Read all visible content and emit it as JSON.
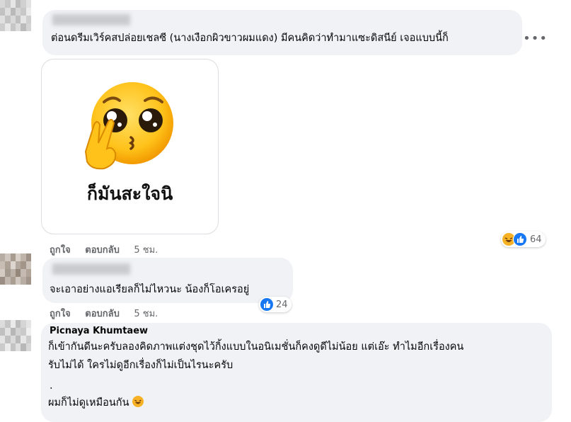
{
  "comments": [
    {
      "text": "ต่อนดรีมเวิร์คสปล่อยเชลซี (นางเงือกผิวขาวผมแดง) มีคนคิดว่าทำมาแซะดิสนีย์ เจอแบบนี้ก็",
      "sticker_caption": "ก็มันสะใจนิ",
      "like_label": "ถูกใจ",
      "reply_label": "ตอบกลับ",
      "time": "5 ชม.",
      "reaction_count": "64",
      "more_icon": "more-horizontal-icon"
    },
    {
      "text": "จะเอาอย่างแอเรียลก็ไม่ไหวนะ น้องก็โอเครอยู่",
      "like_label": "ถูกใจ",
      "reply_label": "ตอบกลับ",
      "time": "5 ชม.",
      "reaction_count": "24"
    },
    {
      "author": "Picnaya Khumtaew",
      "line1": "ก็เข้ากันดีนะครับลองคิดภาพแต่งชุดไว้กิ้งแบบในอนิเมชั่นก็คงดูดีไม่น้อย แต่เอ๊ะ ทำไมอีกเรื่องคน",
      "line2": "รับไม่ได้ ใครไม่ดูอีกเรื่องก็ไม่เป็นไรนะครับ",
      "line3": ".",
      "line4": "ผมก็ไม่ดูเหมือนกัน"
    }
  ],
  "colors": {
    "bubble": "#f0f2f5",
    "meta": "#65676b",
    "like_blue": "#1877f2",
    "haha_yellow": "#f7b125"
  }
}
